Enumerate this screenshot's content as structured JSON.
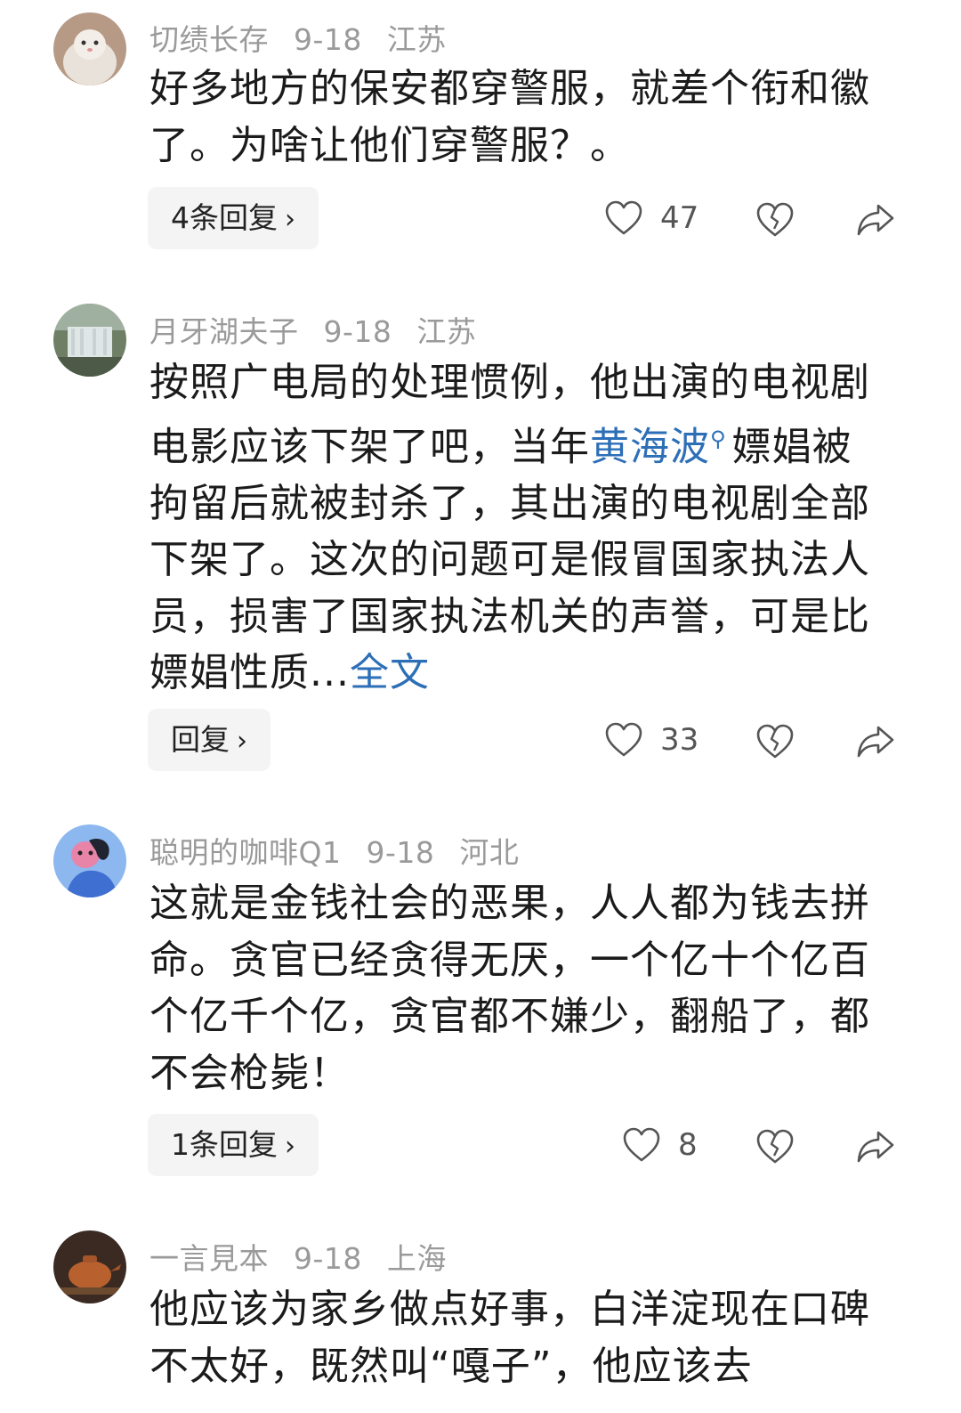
{
  "comments": [
    {
      "user": "切绩长存",
      "date": "9-18",
      "location": "江苏",
      "text": "好多地方的保安都穿警服，就差个衔和徽了。为啥让他们穿警服？。",
      "reply_label": "4条回复",
      "likes": "47"
    },
    {
      "user": "月牙湖夫子",
      "date": "9-18",
      "location": "江苏",
      "text_before": "按照广电局的处理惯例，他出演的电视剧电影应该下架了吧，当年",
      "link": "黄海波",
      "text_after": "嫖娼被拘留后就被封杀了，其出演的电视剧全部下架了。这次的问题可是假冒国家执法人员，损害了国家执法机关的声誉，可是比嫖娼性质...",
      "more": "全文",
      "reply_label": "回复",
      "likes": "33"
    },
    {
      "user": "聪明的咖啡Q1",
      "date": "9-18",
      "location": "河北",
      "text": "这就是金钱社会的恶果，人人都为钱去拼命。贪官已经贪得无厌，一个亿十个亿百个亿千个亿，贪官都不嫌少，翻船了，都不会枪毙！",
      "reply_label": "1条回复",
      "likes": "8"
    },
    {
      "user": "一言見本",
      "date": "9-18",
      "location": "上海",
      "text": "他应该为家乡做点好事，白洋淀现在口碑不太好，既然叫“嘎子”，他应该去"
    }
  ],
  "colors": {
    "meta": "#9a9a9a",
    "link": "#2d6fb7",
    "reply_bg": "#f4f4f4",
    "icon": "#555555"
  },
  "icons": [
    "heart-icon",
    "broken-heart-icon",
    "share-icon",
    "chevron-right-icon",
    "search-icon"
  ]
}
